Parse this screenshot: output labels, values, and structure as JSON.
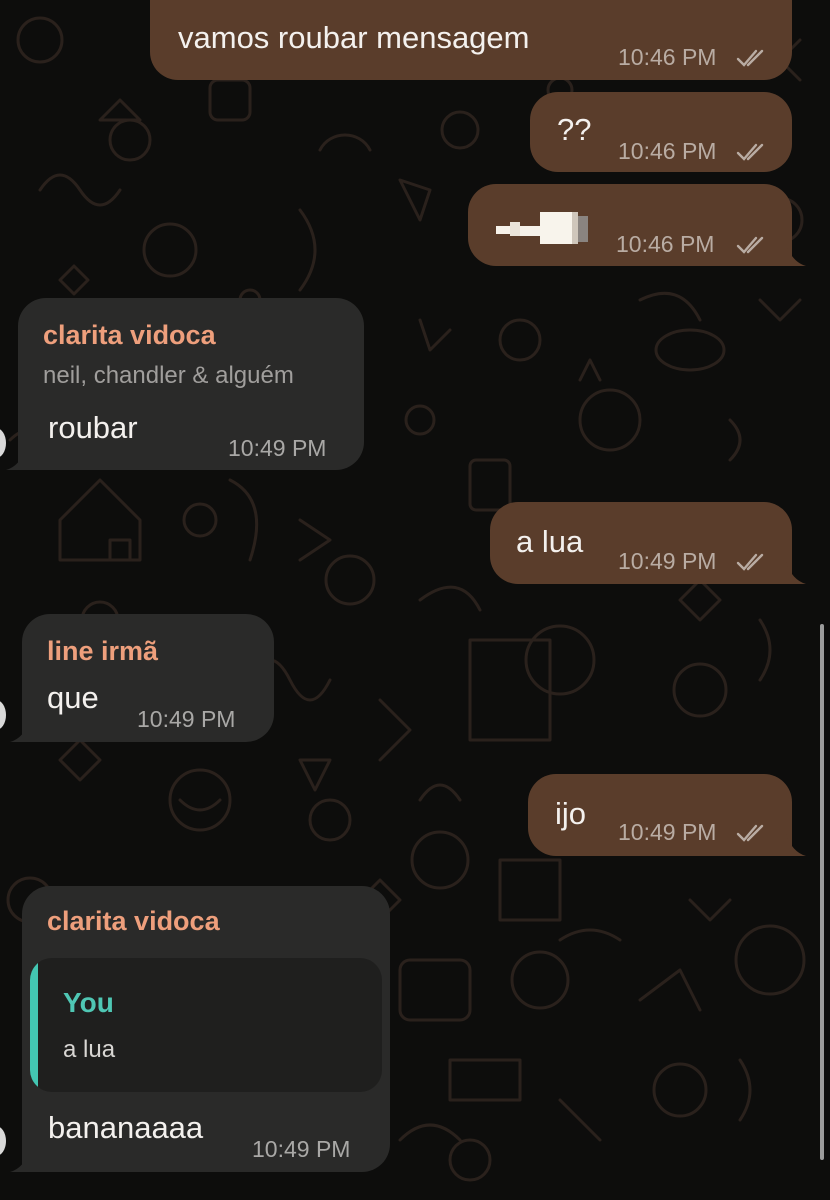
{
  "chat": {
    "messages": [
      {
        "direction": "out",
        "text": "vamos roubar mensagem",
        "time": "10:46 PM",
        "status": "read"
      },
      {
        "direction": "out",
        "text": "??",
        "time": "10:46 PM",
        "status": "read"
      },
      {
        "direction": "out",
        "text": "",
        "media": "redacted-sticker",
        "time": "10:46 PM",
        "time_visible": "10:46 PM",
        "status": "read"
      },
      {
        "direction": "in",
        "sender": "clarita vidoca",
        "subtitle": "neil, chandler & alguém",
        "text": "roubar",
        "time": "10:49 PM"
      },
      {
        "direction": "out",
        "text": "a lua",
        "time": "10:49 PM",
        "status": "read"
      },
      {
        "direction": "in",
        "sender": "line irmã",
        "text": "que",
        "time": "10:49 PM"
      },
      {
        "direction": "out",
        "text": "ijo",
        "time": "10:49 PM",
        "status": "read"
      },
      {
        "direction": "in",
        "sender": "clarita vidoca",
        "quote": {
          "author": "You",
          "text": "a lua"
        },
        "text": "bananaaaa",
        "time": "10:49 PM"
      }
    ]
  },
  "colors": {
    "background": "#0d0d0c",
    "outgoing_bubble": "#5a3d2b",
    "incoming_bubble": "#2a2a29",
    "sender_name": "#ee9f7c",
    "quote_author": "#4fc7b4",
    "quote_bar": "#43c6b2"
  },
  "icons": {
    "read_receipt": "double-check-icon"
  }
}
